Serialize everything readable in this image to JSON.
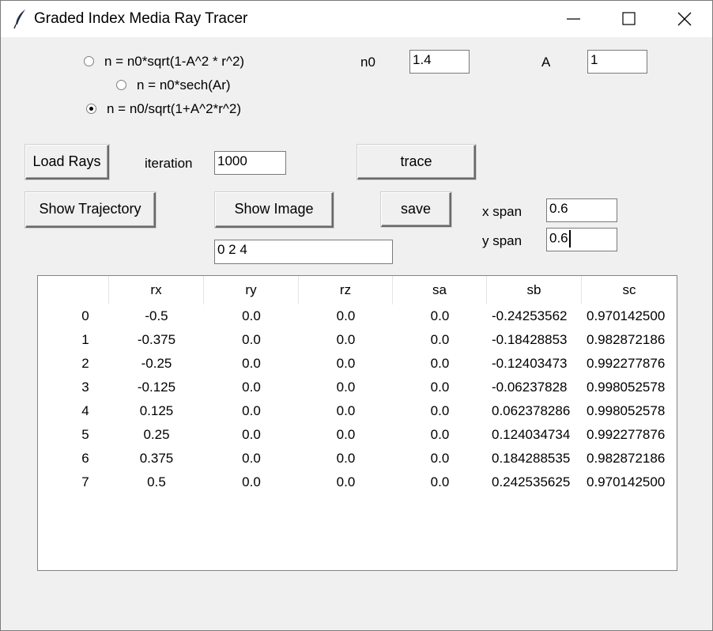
{
  "window": {
    "title": "Graded Index Media Ray Tracer"
  },
  "model": {
    "options": [
      {
        "label": "n = n0*sqrt(1-A^2 * r^2)",
        "selected": false
      },
      {
        "label": "n = n0*sech(Ar)",
        "selected": false
      },
      {
        "label": "n = n0/sqrt(1+A^2*r^2)",
        "selected": true
      }
    ],
    "n0_label": "n0",
    "n0_value": "1.4",
    "a_label": "A",
    "a_value": "1"
  },
  "controls": {
    "load_rays": "Load Rays",
    "iteration_label": "iteration",
    "iteration_value": "1000",
    "trace": "trace",
    "show_trajectory": "Show Trajectory",
    "show_image": "Show Image",
    "image_indices": "0 2 4",
    "save": "save",
    "x_span_label": "x span",
    "x_span_value": "0.6",
    "y_span_label": "y span",
    "y_span_value": "0.6"
  },
  "table": {
    "columns": [
      "",
      "rx",
      "ry",
      "rz",
      "sa",
      "sb",
      "sc"
    ],
    "rows": [
      [
        "0",
        "-0.5",
        "0.0",
        "0.0",
        "0.0",
        "-0.24253562",
        "0.970142500"
      ],
      [
        "1",
        "-0.375",
        "0.0",
        "0.0",
        "0.0",
        "-0.18428853",
        "0.982872186"
      ],
      [
        "2",
        "-0.25",
        "0.0",
        "0.0",
        "0.0",
        "-0.12403473",
        "0.992277876"
      ],
      [
        "3",
        "-0.125",
        "0.0",
        "0.0",
        "0.0",
        "-0.06237828",
        "0.998052578"
      ],
      [
        "4",
        "0.125",
        "0.0",
        "0.0",
        "0.0",
        "0.062378286",
        "0.998052578"
      ],
      [
        "5",
        "0.25",
        "0.0",
        "0.0",
        "0.0",
        "0.124034734",
        "0.992277876"
      ],
      [
        "6",
        "0.375",
        "0.0",
        "0.0",
        "0.0",
        "0.184288535",
        "0.982872186"
      ],
      [
        "7",
        "0.5",
        "0.0",
        "0.0",
        "0.0",
        "0.242535625",
        "0.970142500"
      ]
    ]
  }
}
